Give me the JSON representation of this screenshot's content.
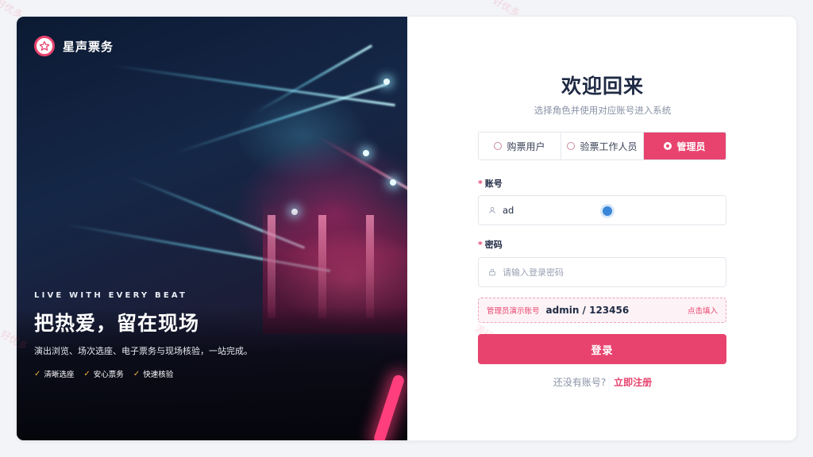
{
  "brand": {
    "name": "星声票务",
    "logo_icon": "star-icon"
  },
  "hero": {
    "tagline": "LIVE WITH EVERY BEAT",
    "headline": "把热爱，留在现场",
    "subline": "演出浏览、场次选座、电子票务与现场核验，一站完成。",
    "features": [
      "清晰选座",
      "安心票务",
      "快速核验"
    ]
  },
  "form": {
    "title": "欢迎回来",
    "subtitle": "选择角色并使用对应账号进入系统",
    "roles": [
      {
        "label": "购票用户",
        "active": false
      },
      {
        "label": "验票工作人员",
        "active": false
      },
      {
        "label": "管理员",
        "active": true
      }
    ],
    "account": {
      "label": "账号",
      "value": "ad"
    },
    "password": {
      "label": "密码",
      "placeholder": "请输入登录密码"
    },
    "demo": {
      "label": "管理员演示账号",
      "credentials": "admin / 123456",
      "fill_label": "点击填入"
    },
    "login_label": "登录",
    "register": {
      "question": "还没有账号?",
      "link": "立即注册"
    }
  },
  "colors": {
    "accent": "#e8436e",
    "title": "#1f2a44",
    "muted": "#8a92a6"
  }
}
